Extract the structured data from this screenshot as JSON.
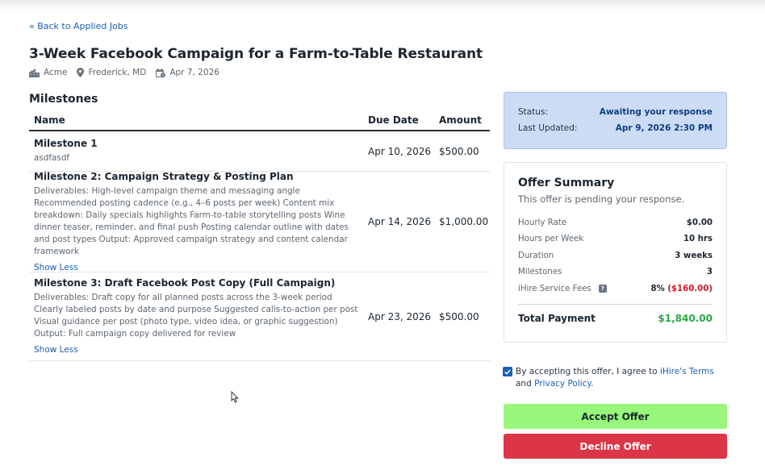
{
  "nav": {
    "back_label": "« Back to Applied Jobs"
  },
  "job": {
    "title": "3-Week Facebook Campaign for a Farm-to-Table Restaurant",
    "company": "Acme",
    "location": "Frederick, MD",
    "date": "Apr 7, 2026",
    "company_icon": "buildings-icon",
    "location_icon": "map-pin-icon",
    "date_icon": "calendar-icon"
  },
  "milestones": {
    "heading": "Milestones",
    "columns": {
      "name": "Name",
      "due": "Due Date",
      "amount": "Amount"
    },
    "rows": [
      {
        "title": "Milestone 1",
        "description": "asdfasdf",
        "due": "Apr 10, 2026",
        "amount": "$500.00"
      },
      {
        "title": "Milestone 2: Campaign Strategy & Posting Plan",
        "description": "Deliverables: High-level campaign theme and messaging angle Recommended posting cadence (e.g., 4–6 posts per week) Content mix breakdown: Daily specials highlights Farm-to-table storytelling posts Wine dinner teaser, reminder, and final push Posting calendar outline with dates and post types Output: Approved campaign strategy and content calendar framework",
        "toggle": "Show Less",
        "due": "Apr 14, 2026",
        "amount": "$1,000.00"
      },
      {
        "title": "Milestone 3: Draft Facebook Post Copy (Full Campaign)",
        "description": "Deliverables: Draft copy for all planned posts across the 3-week period Clearly labeled posts by date and purpose Suggested calls-to-action per post Visual guidance per post (photo type, video idea, or graphic suggestion) Output: Full campaign copy delivered for review",
        "toggle": "Show Less",
        "due": "Apr 23, 2026",
        "amount": "$500.00"
      }
    ]
  },
  "status": {
    "status_label": "Status:",
    "status_value": "Awaiting your response",
    "updated_label": "Last Updated:",
    "updated_value": "Apr 9, 2026 2:30 PM"
  },
  "offer": {
    "title": "Offer Summary",
    "subtitle": "This offer is pending your response.",
    "rows": [
      {
        "label": "Hourly Rate",
        "value": "$0.00"
      },
      {
        "label": "Hours per Week",
        "value": "10 hrs"
      },
      {
        "label": "Duration",
        "value": "3 weeks"
      },
      {
        "label": "Milestones",
        "value": "3"
      }
    ],
    "fee_label": "iHire Service Fees",
    "fee_icon": "help-icon",
    "fee_percent": "8%",
    "fee_amount": "($160.00)",
    "total_label": "Total Payment",
    "total_value": "$1,840.00"
  },
  "agreement": {
    "checked": true,
    "prefix": "By accepting this offer, I agree to ",
    "terms_link": "iHire's Terms",
    "middle": " and ",
    "privacy_link": "Privacy Policy",
    "suffix": "."
  },
  "actions": {
    "accept": "Accept Offer",
    "decline": "Decline Offer"
  },
  "colors": {
    "link": "#1a5fb4",
    "status_bg": "#ccdcf5",
    "status_text": "#0f3e84",
    "accept_bg": "#98f77a",
    "decline_bg": "#dc3545",
    "total": "#28a745",
    "fee_negative": "#d11a2a"
  }
}
